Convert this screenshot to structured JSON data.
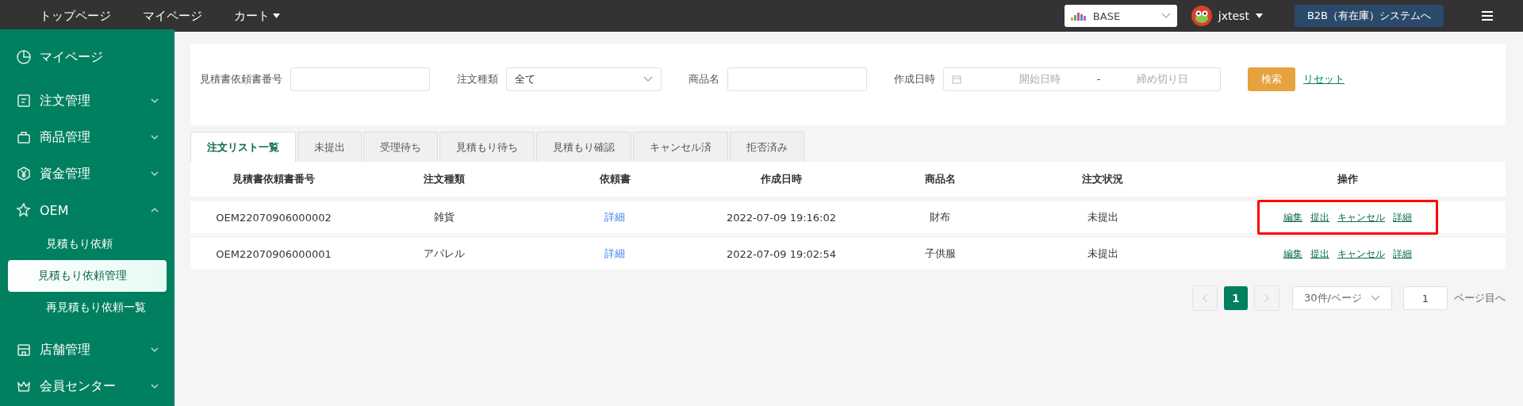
{
  "top_nav": {
    "links": [
      {
        "label": "トップページ",
        "dropdown": false
      },
      {
        "label": "マイページ",
        "dropdown": false
      },
      {
        "label": "カート",
        "dropdown": true
      }
    ],
    "shop_select": {
      "value": "BASE"
    },
    "user": {
      "name": "jxtest"
    },
    "system_button": "B2B（有在庫）システムへ"
  },
  "sidebar": {
    "items": [
      {
        "label": "マイページ"
      },
      {
        "label": "注文管理",
        "expanded": false
      },
      {
        "label": "商品管理",
        "expanded": false
      },
      {
        "label": "資金管理",
        "expanded": false
      },
      {
        "label": "OEM",
        "expanded": true,
        "children": [
          {
            "label": "見積もり依頼",
            "selected": false
          },
          {
            "label": "見積もり依頼管理",
            "selected": true
          },
          {
            "label": "再見積もり依頼一覧",
            "selected": false
          }
        ]
      },
      {
        "label": "店舗管理",
        "expanded": false
      },
      {
        "label": "会員センター",
        "expanded": false
      }
    ]
  },
  "filters": {
    "quote_number": {
      "label": "見積書依頼書番号"
    },
    "order_type": {
      "label": "注文種類",
      "value": "全て"
    },
    "product_name": {
      "label": "商品名"
    },
    "created": {
      "label": "作成日時",
      "start_placeholder": "開始日時",
      "separator": "-",
      "end_placeholder": "締め切り日"
    },
    "search_button": "検索",
    "reset_link": "リセット"
  },
  "tabs": [
    {
      "label": "注文リスト一覧",
      "selected": true
    },
    {
      "label": "未提出",
      "selected": false
    },
    {
      "label": "受理待ち",
      "selected": false
    },
    {
      "label": "見積もり待ち",
      "selected": false
    },
    {
      "label": "見積もり確認",
      "selected": false
    },
    {
      "label": "キャンセル済",
      "selected": false
    },
    {
      "label": "拒否済み",
      "selected": false
    }
  ],
  "table": {
    "columns": [
      "見積書依頼書番号",
      "注文種類",
      "依頼書",
      "作成日時",
      "商品名",
      "注文状況",
      "操作"
    ],
    "rows": [
      {
        "number": "OEM22070906000002",
        "type": "雑貨",
        "document": "詳細",
        "created": "2022-07-09 19:16:02",
        "product": "財布",
        "status": "未提出",
        "actions": [
          "編集",
          "提出",
          "キャンセル",
          "詳細"
        ],
        "highlighted": true
      },
      {
        "number": "OEM22070906000001",
        "type": "アパレル",
        "document": "詳細",
        "created": "2022-07-09 19:02:54",
        "product": "子供服",
        "status": "未提出",
        "actions": [
          "編集",
          "提出",
          "キャンセル",
          "詳細"
        ],
        "highlighted": false
      }
    ]
  },
  "pagination": {
    "pages": [
      {
        "label": "1",
        "selected": true
      }
    ],
    "page_size": "30件/ページ",
    "jump_value": "1",
    "jump_label": "ページ目へ"
  }
}
